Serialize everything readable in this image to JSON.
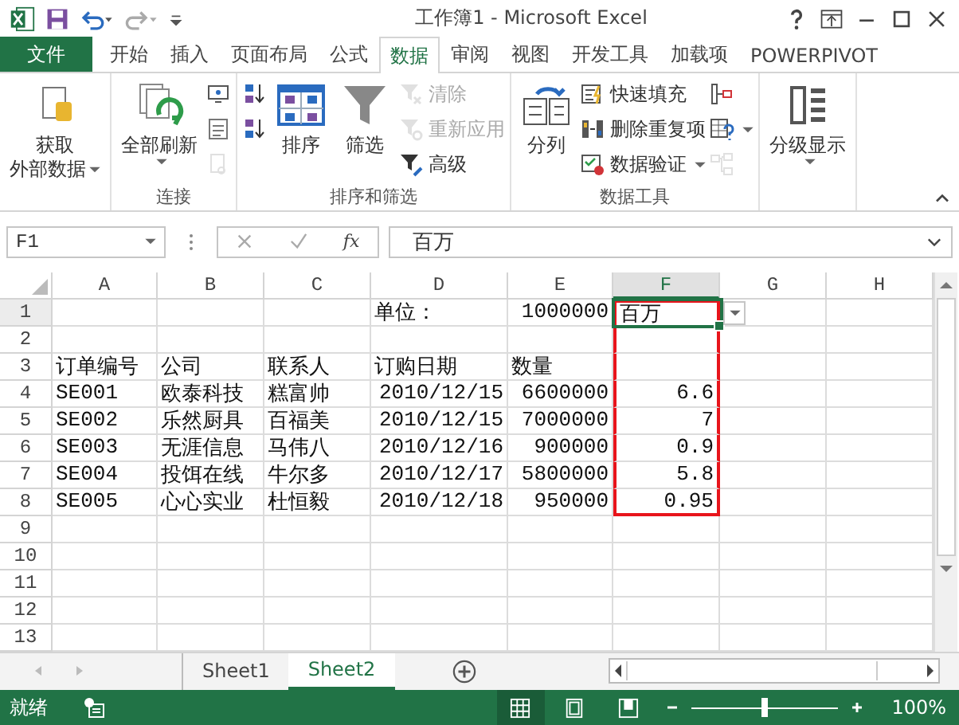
{
  "window": {
    "title": "工作簿1 - Microsoft Excel"
  },
  "tabs": [
    {
      "label": "文件",
      "kind": "file",
      "selected": false
    },
    {
      "label": "开始",
      "kind": "tab",
      "selected": false
    },
    {
      "label": "插入",
      "kind": "tab",
      "selected": false
    },
    {
      "label": "页面布局",
      "kind": "tab",
      "selected": false
    },
    {
      "label": "公式",
      "kind": "tab",
      "selected": false
    },
    {
      "label": "数据",
      "kind": "tab",
      "selected": true
    },
    {
      "label": "审阅",
      "kind": "tab",
      "selected": false
    },
    {
      "label": "视图",
      "kind": "tab",
      "selected": false
    },
    {
      "label": "开发工具",
      "kind": "tab",
      "selected": false
    },
    {
      "label": "加载项",
      "kind": "tab",
      "selected": false
    },
    {
      "label": "POWERPIVOT",
      "kind": "tab",
      "selected": false
    }
  ],
  "ribbon": {
    "groups": [
      {
        "columns": [
          {
            "kind": "large",
            "lines": [
              "获取",
              "外部数据"
            ],
            "dropdown": true,
            "disabled": false
          }
        ]
      },
      {
        "label": "连接",
        "columns": [
          {
            "kind": "large",
            "lines": [
              "全部刷新"
            ],
            "dropdown": true,
            "disabled": false
          },
          {
            "kind": "stack",
            "items": [
              {
                "kind": "icon",
                "disabled": false
              },
              {
                "kind": "icon",
                "disabled": false
              },
              {
                "kind": "icon",
                "disabled": true
              }
            ]
          }
        ]
      },
      {
        "label": "排序和筛选",
        "columns": [
          {
            "kind": "stack",
            "items": [
              {
                "kind": "icon",
                "disabled": false
              },
              {
                "kind": "icon",
                "disabled": false
              }
            ]
          },
          {
            "kind": "large",
            "lines": [
              "排序"
            ],
            "dropdown": false,
            "disabled": false
          },
          {
            "kind": "large",
            "lines": [
              "筛选"
            ],
            "dropdown": false,
            "disabled": false
          },
          {
            "kind": "stack",
            "items": [
              {
                "kind": "small",
                "label": "清除",
                "disabled": true
              },
              {
                "kind": "small",
                "label": "重新应用",
                "disabled": true
              },
              {
                "kind": "small",
                "label": "高级",
                "disabled": false
              }
            ]
          }
        ]
      },
      {
        "label": "数据工具",
        "columns": [
          {
            "kind": "large",
            "lines": [
              "分列"
            ],
            "dropdown": false,
            "disabled": false
          },
          {
            "kind": "stack",
            "items": [
              {
                "kind": "small",
                "label": "快速填充",
                "disabled": false
              },
              {
                "kind": "small",
                "label": "删除重复项",
                "disabled": false
              },
              {
                "kind": "small",
                "label": "数据验证",
                "dropdown": true,
                "disabled": false
              }
            ]
          },
          {
            "kind": "stack",
            "items": [
              {
                "kind": "icon",
                "disabled": false
              },
              {
                "kind": "icon",
                "dropdown": true,
                "disabled": false
              },
              {
                "kind": "icon",
                "disabled": true
              }
            ]
          }
        ]
      },
      {
        "columns": [
          {
            "kind": "large",
            "lines": [
              "分级显示"
            ],
            "dropdown": true,
            "disabled": false
          }
        ]
      }
    ]
  },
  "formula_bar": {
    "name_box": "F1",
    "function_button": "fx",
    "value": "百万"
  },
  "sheet": {
    "cell_dropdown": true,
    "columns": [
      {
        "label": "A",
        "selected": false
      },
      {
        "label": "B",
        "selected": false
      },
      {
        "label": "C",
        "selected": false
      },
      {
        "label": "D",
        "selected": false
      },
      {
        "label": "E",
        "selected": false
      },
      {
        "label": "F",
        "selected": true
      },
      {
        "label": "G",
        "selected": false
      },
      {
        "label": "H",
        "selected": false
      }
    ],
    "rows": [
      {
        "label": "1",
        "selected": true,
        "highlighted": true,
        "cells": [
          null,
          null,
          null,
          {
            "text": "单位：",
            "kind": "text"
          },
          {
            "text": "1000000",
            "kind": "number"
          },
          {
            "text": "百万",
            "kind": "text"
          },
          null,
          null
        ]
      },
      {
        "label": "2",
        "selected": false,
        "highlighted": true,
        "cells": [
          null,
          null,
          null,
          null,
          null,
          null,
          null,
          null
        ]
      },
      {
        "label": "3",
        "selected": false,
        "highlighted": true,
        "cells": [
          {
            "text": "订单编号",
            "kind": "text"
          },
          {
            "text": "公司",
            "kind": "text"
          },
          {
            "text": "联系人",
            "kind": "text"
          },
          {
            "text": "订购日期",
            "kind": "text"
          },
          {
            "text": "数量",
            "kind": "text"
          },
          null,
          null,
          null
        ]
      },
      {
        "label": "4",
        "selected": false,
        "highlighted": true,
        "cells": [
          {
            "text": "SE001",
            "kind": "text"
          },
          {
            "text": "欧泰科技",
            "kind": "text"
          },
          {
            "text": "糕富帅",
            "kind": "text"
          },
          {
            "text": "2010/12/15",
            "kind": "number"
          },
          {
            "text": "6600000",
            "kind": "number"
          },
          {
            "text": "6.6",
            "kind": "number"
          },
          null,
          null
        ]
      },
      {
        "label": "5",
        "selected": false,
        "highlighted": true,
        "cells": [
          {
            "text": "SE002",
            "kind": "text"
          },
          {
            "text": "乐然厨具",
            "kind": "text"
          },
          {
            "text": "百福美",
            "kind": "text"
          },
          {
            "text": "2010/12/15",
            "kind": "number"
          },
          {
            "text": "7000000",
            "kind": "number"
          },
          {
            "text": "7",
            "kind": "number"
          },
          null,
          null
        ]
      },
      {
        "label": "6",
        "selected": false,
        "highlighted": true,
        "cells": [
          {
            "text": "SE003",
            "kind": "text"
          },
          {
            "text": "无涯信息",
            "kind": "text"
          },
          {
            "text": "马伟八",
            "kind": "text"
          },
          {
            "text": "2010/12/16",
            "kind": "number"
          },
          {
            "text": "900000",
            "kind": "number"
          },
          {
            "text": "0.9",
            "kind": "number"
          },
          null,
          null
        ]
      },
      {
        "label": "7",
        "selected": false,
        "highlighted": true,
        "cells": [
          {
            "text": "SE004",
            "kind": "text"
          },
          {
            "text": "投饵在线",
            "kind": "text"
          },
          {
            "text": "牛尔多",
            "kind": "text"
          },
          {
            "text": "2010/12/17",
            "kind": "number"
          },
          {
            "text": "5800000",
            "kind": "number"
          },
          {
            "text": "5.8",
            "kind": "number"
          },
          null,
          null
        ]
      },
      {
        "label": "8",
        "selected": false,
        "highlighted": true,
        "cells": [
          {
            "text": "SE005",
            "kind": "text"
          },
          {
            "text": "心心实业",
            "kind": "text"
          },
          {
            "text": "杜恒毅",
            "kind": "text"
          },
          {
            "text": "2010/12/18",
            "kind": "number"
          },
          {
            "text": "950000",
            "kind": "number"
          },
          {
            "text": "0.95",
            "kind": "number"
          },
          null,
          null
        ]
      },
      {
        "label": "9",
        "selected": false,
        "highlighted": false,
        "cells": [
          null,
          null,
          null,
          null,
          null,
          null,
          null,
          null
        ]
      },
      {
        "label": "10",
        "selected": false,
        "highlighted": false,
        "cells": [
          null,
          null,
          null,
          null,
          null,
          null,
          null,
          null
        ]
      },
      {
        "label": "11",
        "selected": false,
        "highlighted": false,
        "cells": [
          null,
          null,
          null,
          null,
          null,
          null,
          null,
          null
        ]
      },
      {
        "label": "12",
        "selected": false,
        "highlighted": false,
        "cells": [
          null,
          null,
          null,
          null,
          null,
          null,
          null,
          null
        ]
      },
      {
        "label": "13",
        "selected": false,
        "highlighted": false,
        "cells": [
          null,
          null,
          null,
          null,
          null,
          null,
          null,
          null
        ]
      }
    ]
  },
  "sheet_tabs": [
    {
      "label": "Sheet1",
      "selected": false
    },
    {
      "label": "Sheet2",
      "selected": true
    }
  ],
  "status_bar": {
    "status": "就绪",
    "views": [
      {
        "selected": true
      },
      {
        "selected": false
      },
      {
        "selected": false
      }
    ],
    "zoom": {
      "level": 0.5,
      "reading": "100%"
    }
  }
}
